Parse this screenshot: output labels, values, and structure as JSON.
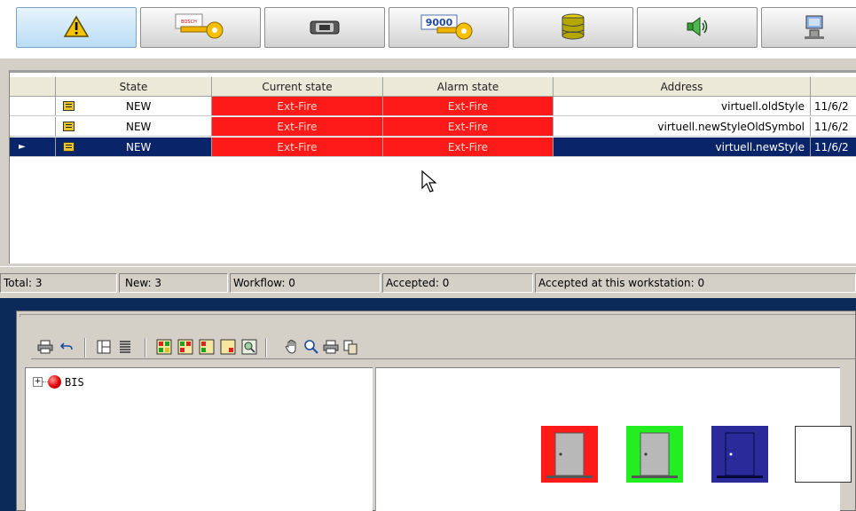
{
  "toolbar": {
    "buttons": [
      {
        "name": "alarm-warning",
        "icon": "warning-triangle-icon"
      },
      {
        "name": "bosch-key",
        "icon": "bosch-key-icon"
      },
      {
        "name": "camera",
        "icon": "camera-icon"
      },
      {
        "name": "key-9000",
        "icon": "key-9000-icon",
        "text": "9000"
      },
      {
        "name": "database",
        "icon": "database-icon"
      },
      {
        "name": "audio",
        "icon": "speaker-icon"
      },
      {
        "name": "computer",
        "icon": "computer-icon"
      }
    ],
    "bosch_text": "BOSCH"
  },
  "grid": {
    "headers": [
      "",
      "State",
      "Current state",
      "Alarm state",
      "Address",
      ""
    ],
    "rows": [
      {
        "state": "NEW",
        "current": "Ext-Fire",
        "alarm": "Ext-Fire",
        "address": "virtuell.oldStyle",
        "date": "11/6/2",
        "selected": false
      },
      {
        "state": "NEW",
        "current": "Ext-Fire",
        "alarm": "Ext-Fire",
        "address": "virtuell.newStyleOldSymbol",
        "date": "11/6/2",
        "selected": false
      },
      {
        "state": "NEW",
        "current": "Ext-Fire",
        "alarm": "Ext-Fire",
        "address": "virtuell.newStyle",
        "date": "11/6/2",
        "selected": true
      }
    ],
    "selected_marker": "►"
  },
  "status": {
    "total": "Total: 3",
    "new": "New: 3",
    "workflow": "Workflow: 0",
    "accepted": "Accepted: 0",
    "accepted_ws": "Accepted at this workstation: 0"
  },
  "tree": {
    "expander": "+",
    "root": "BIS"
  },
  "doors": [
    {
      "frame": "#ff1a1a",
      "door": "#b8b8b8",
      "state": "alarm"
    },
    {
      "frame": "#22ee22",
      "door": "#b8b8b8",
      "state": "ok"
    },
    {
      "frame": "#2a2a9a",
      "door": "#2a2a9a",
      "state": "selected"
    },
    {
      "frame": "#ffffff",
      "door": "#ffffff",
      "state": "unknown"
    }
  ],
  "colors": {
    "alarm_red": "#ff1a1a",
    "selection_blue": "#0a246a",
    "panel_blue": "#0b2a5a"
  }
}
